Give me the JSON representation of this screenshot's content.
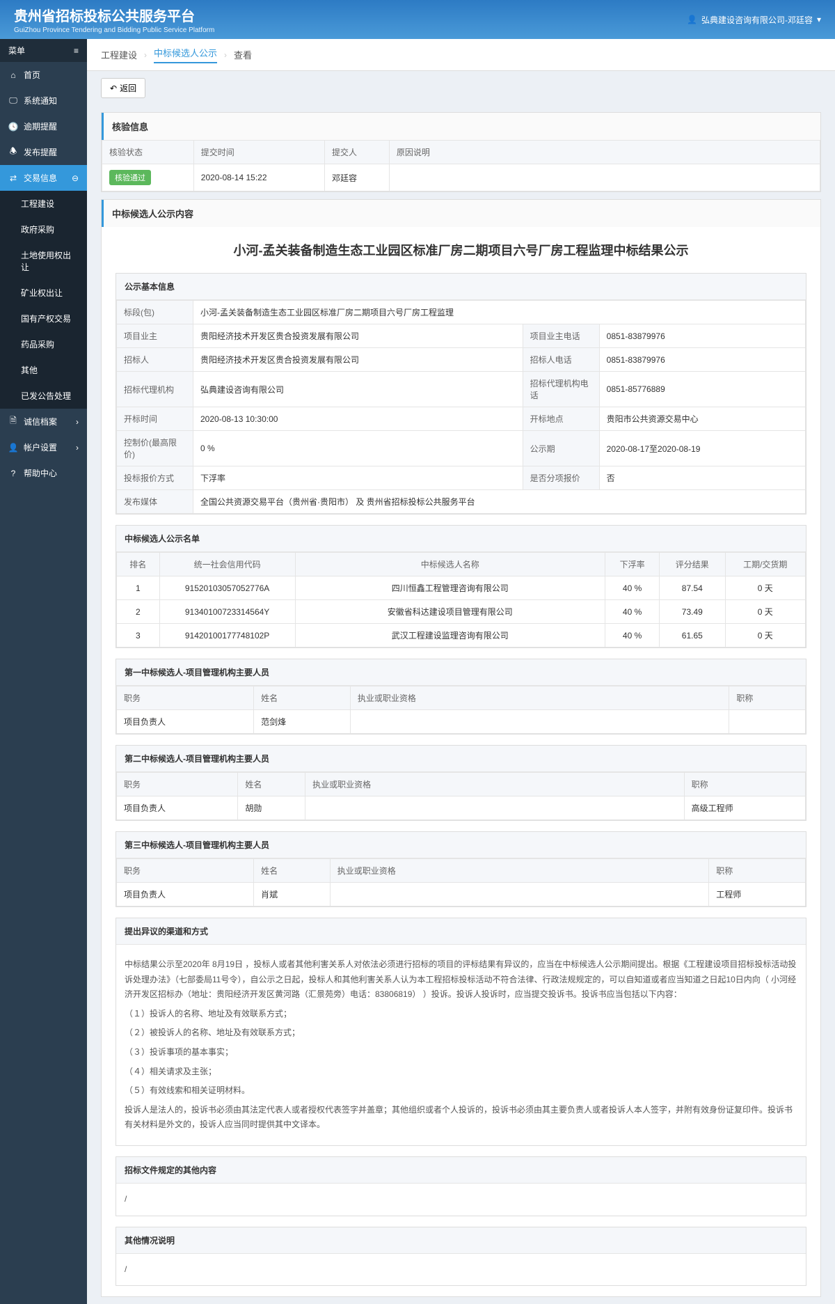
{
  "header": {
    "title": "贵州省招标投标公共服务平台",
    "subtitle": "GuiZhou Province Tendering and Bidding Public Service Platform",
    "user": "弘典建设咨询有限公司-邓廷容"
  },
  "sidebar": {
    "menu_label": "菜单",
    "items": [
      {
        "icon": "home",
        "label": "首页"
      },
      {
        "icon": "monitor",
        "label": "系统通知"
      },
      {
        "icon": "clock",
        "label": "逾期提醒"
      },
      {
        "icon": "bell",
        "label": "发布提醒"
      },
      {
        "icon": "exchange",
        "label": "交易信息",
        "active": true
      }
    ],
    "sub_items": [
      {
        "label": "工程建设"
      },
      {
        "label": "政府采购"
      },
      {
        "label": "土地使用权出让"
      },
      {
        "label": "矿业权出让"
      },
      {
        "label": "国有产权交易"
      },
      {
        "label": "药品采购"
      },
      {
        "label": "其他"
      },
      {
        "label": "已发公告处理"
      }
    ],
    "bottom_items": [
      {
        "icon": "file",
        "label": "诚信档案"
      },
      {
        "icon": "user",
        "label": "帐户设置"
      },
      {
        "icon": "help",
        "label": "帮助中心"
      }
    ]
  },
  "breadcrumb": {
    "items": [
      "工程建设",
      "中标候选人公示",
      "查看"
    ]
  },
  "back_button": "返回",
  "verify_section": {
    "title": "核验信息",
    "headers": [
      "核验状态",
      "提交时间",
      "提交人",
      "原因说明"
    ],
    "row": {
      "status": "核验通过",
      "time": "2020-08-14 15:22",
      "person": "邓廷容",
      "reason": ""
    }
  },
  "content_section_title": "中标候选人公示内容",
  "page_title": "小河-孟关装备制造生态工业园区标准厂房二期项目六号厂房工程监理中标结果公示",
  "basic_info": {
    "title": "公示基本信息",
    "rows": [
      [
        {
          "label": "标段(包)",
          "value": "小河-孟关装备制造生态工业园区标准厂房二期项目六号厂房工程监理",
          "colspan": 3
        }
      ],
      [
        {
          "label": "项目业主",
          "value": "贵阳经济技术开发区贵合投资发展有限公司"
        },
        {
          "label": "项目业主电话",
          "value": "0851-83879976"
        }
      ],
      [
        {
          "label": "招标人",
          "value": "贵阳经济技术开发区贵合投资发展有限公司"
        },
        {
          "label": "招标人电话",
          "value": "0851-83879976"
        }
      ],
      [
        {
          "label": "招标代理机构",
          "value": "弘典建设咨询有限公司"
        },
        {
          "label": "招标代理机构电话",
          "value": "0851-85776889"
        }
      ],
      [
        {
          "label": "开标时间",
          "value": "2020-08-13 10:30:00"
        },
        {
          "label": "开标地点",
          "value": "贵阳市公共资源交易中心"
        }
      ],
      [
        {
          "label": "控制价(最高限价)",
          "value": "0 %"
        },
        {
          "label": "公示期",
          "value": "2020-08-17至2020-08-19"
        }
      ],
      [
        {
          "label": "投标报价方式",
          "value": "下浮率"
        },
        {
          "label": "是否分项报价",
          "value": "否"
        }
      ],
      [
        {
          "label": "发布媒体",
          "value": "全国公共资源交易平台（贵州省·贵阳市） 及 贵州省招标投标公共服务平台",
          "colspan": 3
        }
      ]
    ]
  },
  "candidate_list": {
    "title": "中标候选人公示名单",
    "headers": [
      "排名",
      "统一社会信用代码",
      "中标候选人名称",
      "下浮率",
      "评分结果",
      "工期/交货期"
    ],
    "rows": [
      {
        "rank": "1",
        "code": "91520103057052776A",
        "name": "四川恒鑫工程管理咨询有限公司",
        "rate": "40 %",
        "score": "87.54",
        "period": "0 天"
      },
      {
        "rank": "2",
        "code": "91340100723314564Y",
        "name": "安徽省科达建设项目管理有限公司",
        "rate": "40 %",
        "score": "73.49",
        "period": "0 天"
      },
      {
        "rank": "3",
        "code": "91420100177748102P",
        "name": "武汉工程建设监理咨询有限公司",
        "rate": "40 %",
        "score": "61.65",
        "period": "0 天"
      }
    ]
  },
  "personnel_tables": [
    {
      "title": "第一中标候选人-项目管理机构主要人员",
      "headers": [
        "职务",
        "姓名",
        "执业或职业资格",
        "职称"
      ],
      "rows": [
        {
          "position": "项目负责人",
          "name": "范剑烽",
          "qualification": "",
          "title": ""
        }
      ]
    },
    {
      "title": "第二中标候选人-项目管理机构主要人员",
      "headers": [
        "职务",
        "姓名",
        "执业或职业资格",
        "职称"
      ],
      "rows": [
        {
          "position": "项目负责人",
          "name": "胡勋",
          "qualification": "",
          "title": "高级工程师"
        }
      ]
    },
    {
      "title": "第三中标候选人-项目管理机构主要人员",
      "headers": [
        "职务",
        "姓名",
        "执业或职业资格",
        "职称"
      ],
      "rows": [
        {
          "position": "项目负责人",
          "name": "肖斌",
          "qualification": "",
          "title": "工程师"
        }
      ]
    }
  ],
  "objection": {
    "title": "提出异议的渠道和方式",
    "content": "中标结果公示至2020年 8月19日 ，投标人或者其他利害关系人对依法必须进行招标的项目的评标结果有异议的，应当在中标候选人公示期间提出。根据《工程建设项目招标投标活动投诉处理办法》（七部委局11号令），自公示之日起，投标人和其他利害关系人认为本工程招标投标活动不符合法律、行政法规规定的，可以自知道或者应当知道之日起10日内向（ 小河经济开发区招标办（地址：贵阳经济开发区黄河路（汇景苑旁）电话：83806819） ）投诉。投诉人投诉时，应当提交投诉书。投诉书应当包括以下内容：\n\n（１）投诉人的名称、地址及有效联系方式；\n\n（２）被投诉人的名称、地址及有效联系方式；\n\n（３）投诉事项的基本事实；\n\n（４）相关请求及主张；\n\n（５）有效线索和相关证明材料。\n\n投诉人是法人的，投诉书必须由其法定代表人或者授权代表签字并盖章；其他组织或者个人投诉的，投诉书必须由其主要负责人或者投诉人本人签字，并附有效身份证复印件。投诉书有关材料是外文的，投诉人应当同时提供其中文译本。"
  },
  "other_docs": {
    "title": "招标文件规定的其他内容",
    "content": "/"
  },
  "other_info": {
    "title": "其他情况说明",
    "content": "/"
  }
}
